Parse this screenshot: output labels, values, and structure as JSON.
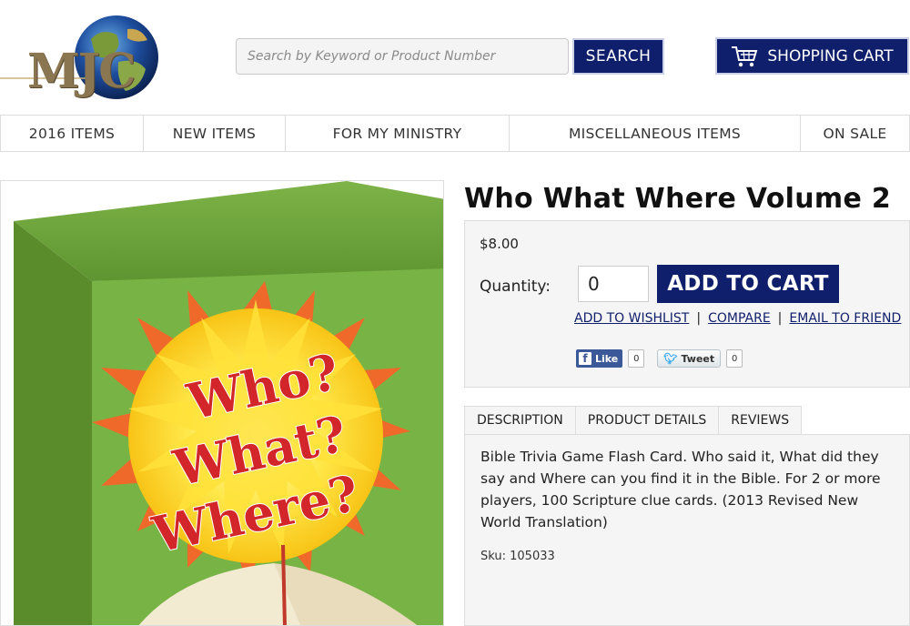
{
  "header": {
    "logo_text": "MJC",
    "search_placeholder": "Search by Keyword or Product Number",
    "search_label": "SEARCH",
    "cart_label": "SHOPPING CART"
  },
  "nav": {
    "items": [
      {
        "label": "2016 ITEMS"
      },
      {
        "label": "NEW ITEMS"
      },
      {
        "label": "FOR MY MINISTRY"
      },
      {
        "label": "MISCELLANEOUS ITEMS"
      },
      {
        "label": "ON SALE"
      }
    ]
  },
  "product": {
    "title": "Who What Where Volume 2",
    "price": "$8.00",
    "quantity_label": "Quantity:",
    "quantity_value": "0",
    "add_to_cart_label": "ADD TO CART",
    "links": {
      "wishlist": "ADD TO WISHLIST",
      "compare": "COMPARE",
      "email": "EMAIL TO FRIEND",
      "separator": "|"
    },
    "social": {
      "like_label": "Like",
      "like_count": "0",
      "tweet_label": "Tweet",
      "tweet_count": "0"
    },
    "box_art": {
      "line1": "Who?",
      "line2": "What?",
      "line3": "Where?"
    },
    "tabs": [
      {
        "label": "DESCRIPTION",
        "active": true
      },
      {
        "label": "PRODUCT DETAILS",
        "active": false
      },
      {
        "label": "REVIEWS",
        "active": false
      }
    ],
    "description": "Bible Trivia Game Flash Card. Who said it, What did they say and Where can you find it in the Bible. For 2 or more players, 100 Scripture clue cards. (2013 Revised New World Translation)",
    "sku": "Sku: 105033"
  },
  "colors": {
    "brand_navy": "#0f1f6b",
    "panel_bg": "#f5f5f5",
    "box_green": "#6aa83a",
    "title_red": "#d3262a"
  }
}
